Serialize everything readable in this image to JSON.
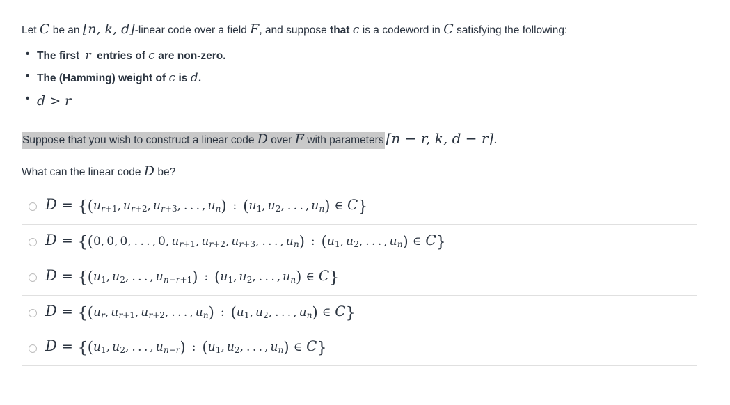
{
  "question": {
    "stem": {
      "t1": "Let ",
      "m1": "C",
      "t2": " be an ",
      "m2": "[n, k, d]",
      "t3": "-linear code over a field ",
      "m3": "F",
      "t4": ", and suppose ",
      "t5": "that ",
      "m4": "c",
      "t6": " is a codeword in ",
      "m5": "C",
      "t7": " satisfying the following:"
    },
    "bullets": [
      {
        "a": "The first ",
        "m1": "r",
        "b": " entries of ",
        "m2": "c",
        "c": " are non-zero."
      },
      {
        "a": "The (Hamming) weight of ",
        "m1": "c",
        "b": " is ",
        "m2": "d",
        "c": "."
      },
      {
        "a": "",
        "m1": "d > r",
        "b": "",
        "m2": "",
        "c": ""
      }
    ],
    "construct_line": {
      "h1": "Suppose that you wish to construct a linear code ",
      "hm1": "D",
      "h2": " over ",
      "hm2": "F",
      "h3": " with parameters",
      "tail_math": "[n − r, k, d − r]",
      "tail_period": "."
    },
    "ask": {
      "a": "What can the linear code ",
      "m": "D",
      "b": " be?"
    }
  },
  "answers": [
    {
      "id": "option-1",
      "lhs": "D",
      "eq": "=",
      "tuple": [
        {
          "base": "u",
          "sub": "r+1"
        },
        {
          "base": "u",
          "sub": "r+2"
        },
        {
          "base": "u",
          "sub": "r+3"
        },
        {
          "base": "...",
          "sub": ""
        },
        {
          "base": "u",
          "sub": "n"
        }
      ],
      "colon": ":",
      "cond_tuple": [
        {
          "base": "u",
          "sub": "1"
        },
        {
          "base": "u",
          "sub": "2"
        },
        {
          "base": "...",
          "sub": ""
        },
        {
          "base": "u",
          "sub": "n"
        }
      ],
      "in": "∈",
      "set": "C",
      "selected": false
    },
    {
      "id": "option-2",
      "lhs": "D",
      "eq": "=",
      "tuple": [
        {
          "base": "0",
          "sub": ""
        },
        {
          "base": "0",
          "sub": ""
        },
        {
          "base": "0",
          "sub": ""
        },
        {
          "base": "...",
          "sub": ""
        },
        {
          "base": "0",
          "sub": ""
        },
        {
          "base": "u",
          "sub": "r+1"
        },
        {
          "base": "u",
          "sub": "r+2"
        },
        {
          "base": "u",
          "sub": "r+3"
        },
        {
          "base": "...",
          "sub": ""
        },
        {
          "base": "u",
          "sub": "n"
        }
      ],
      "colon": ":",
      "cond_tuple": [
        {
          "base": "u",
          "sub": "1"
        },
        {
          "base": "u",
          "sub": "2"
        },
        {
          "base": "...",
          "sub": ""
        },
        {
          "base": "u",
          "sub": "n"
        }
      ],
      "in": "∈",
      "set": "C",
      "selected": false
    },
    {
      "id": "option-3",
      "lhs": "D",
      "eq": "=",
      "tuple": [
        {
          "base": "u",
          "sub": "1"
        },
        {
          "base": "u",
          "sub": "2"
        },
        {
          "base": "...",
          "sub": ""
        },
        {
          "base": "u",
          "sub": "n−r+1"
        }
      ],
      "colon": ":",
      "cond_tuple": [
        {
          "base": "u",
          "sub": "1"
        },
        {
          "base": "u",
          "sub": "2"
        },
        {
          "base": "...",
          "sub": ""
        },
        {
          "base": "u",
          "sub": "n"
        }
      ],
      "in": "∈",
      "set": "C",
      "selected": false
    },
    {
      "id": "option-4",
      "lhs": "D",
      "eq": "=",
      "tuple": [
        {
          "base": "u",
          "sub": "r"
        },
        {
          "base": "u",
          "sub": "r+1"
        },
        {
          "base": "u",
          "sub": "r+2"
        },
        {
          "base": "...",
          "sub": ""
        },
        {
          "base": "u",
          "sub": "n"
        }
      ],
      "colon": ":",
      "cond_tuple": [
        {
          "base": "u",
          "sub": "1"
        },
        {
          "base": "u",
          "sub": "2"
        },
        {
          "base": "...",
          "sub": ""
        },
        {
          "base": "u",
          "sub": "n"
        }
      ],
      "in": "∈",
      "set": "C",
      "selected": false
    },
    {
      "id": "option-5",
      "lhs": "D",
      "eq": "=",
      "tuple": [
        {
          "base": "u",
          "sub": "1"
        },
        {
          "base": "u",
          "sub": "2"
        },
        {
          "base": "...",
          "sub": ""
        },
        {
          "base": "u",
          "sub": "n−r"
        }
      ],
      "colon": ":",
      "cond_tuple": [
        {
          "base": "u",
          "sub": "1"
        },
        {
          "base": "u",
          "sub": "2"
        },
        {
          "base": "...",
          "sub": ""
        },
        {
          "base": "u",
          "sub": "n"
        }
      ],
      "in": "∈",
      "set": "C",
      "selected": false
    }
  ],
  "colors": {
    "text": "#2b3440",
    "highlight": "#c9c9c9",
    "divider": "#e0e0e0",
    "card_border": "#9a9a9a",
    "radio_border": "#bcbcbc"
  }
}
